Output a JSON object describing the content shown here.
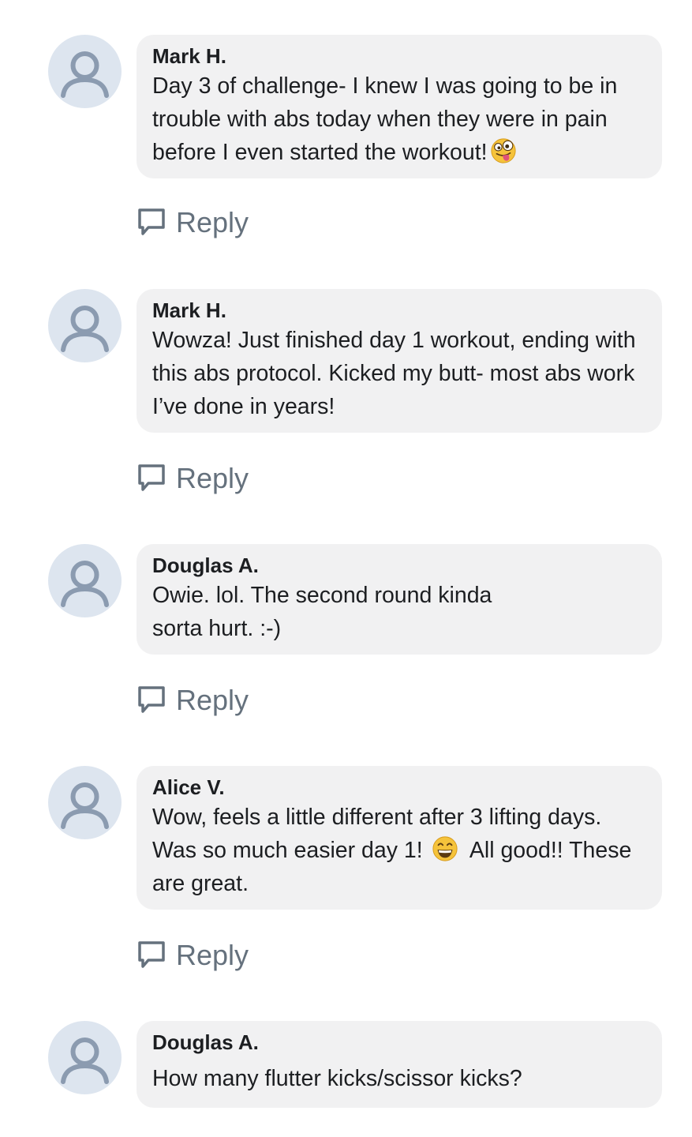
{
  "reply_label": "Reply",
  "colors": {
    "bubble_bg": "#f1f1f2",
    "avatar_bg": "#dde5ef",
    "avatar_glyph": "#8b9bb0",
    "muted_text": "#65717d"
  },
  "comments": [
    {
      "author": "Mark H.",
      "text": "Day 3 of challenge- I knew I was going to be in trouble with abs today when they were in pain before I even started the workout!",
      "emoji": "zany-face-emoji"
    },
    {
      "author": "Mark H.",
      "text": "Wowza! Just finished day 1 workout, ending with this abs protocol. Kicked my butt- most abs work I’ve done in years!"
    },
    {
      "author": "Douglas A.",
      "text": "Owie. lol. The second round kinda\nsorta hurt. :-)"
    },
    {
      "author": "Alice V.",
      "text_before_emoji": "Wow, feels a little different after 3 lifting days.  Was so much easier day 1! ",
      "emoji": "grinning-face-emoji",
      "text_after_emoji": "  All good!! These are great."
    },
    {
      "author": "Douglas A.",
      "text": "How many flutter kicks/scissor kicks?"
    }
  ]
}
